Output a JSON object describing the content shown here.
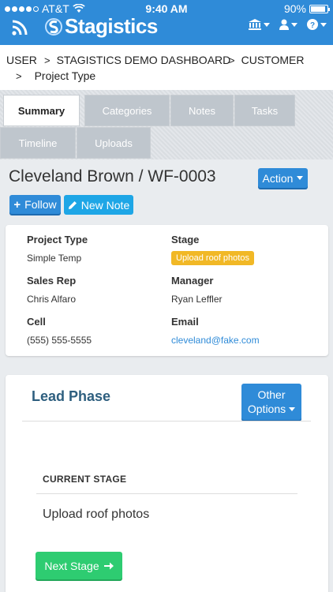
{
  "status_bar": {
    "carrier": "AT&T",
    "time": "9:40 AM",
    "battery": "90%",
    "battery_level": 0.9
  },
  "navbar": {
    "logo_text": "Stagistics",
    "icons": [
      "rss-icon",
      "bank-icon",
      "user-icon",
      "help-icon"
    ]
  },
  "breadcrumb": {
    "items": [
      "USER",
      "STAGISTICS DEMO DASHBOARD",
      "CUSTOMER",
      "Project Type"
    ],
    "separator": ">"
  },
  "tabs": [
    {
      "label": "Summary",
      "active": true
    },
    {
      "label": "Categories",
      "active": false
    },
    {
      "label": "Notes",
      "active": false
    },
    {
      "label": "Tasks",
      "active": false
    },
    {
      "label": "Timeline",
      "active": false
    },
    {
      "label": "Uploads",
      "active": false
    }
  ],
  "header": {
    "title": "Cleveland Brown / WF-0003",
    "action_label": "Action",
    "follow_label": "Follow",
    "new_note_label": "New Note"
  },
  "details": {
    "project_type_label": "Project Type",
    "project_type_value": "Simple Temp",
    "stage_label": "Stage",
    "stage_value": "Upload roof photos",
    "sales_rep_label": "Sales Rep",
    "sales_rep_value": "Chris Alfaro",
    "manager_label": "Manager",
    "manager_value": "Ryan Leffler",
    "cell_label": "Cell",
    "cell_value": "(555) 555-5555",
    "email_label": "Email",
    "email_value": "cleveland@fake.com"
  },
  "phase": {
    "title": "Lead Phase",
    "other_options_line1": "Other",
    "other_options_line2": "Options",
    "current_stage_label": "CURRENT STAGE",
    "current_stage_value": "Upload roof photos",
    "next_stage_label": "Next Stage"
  },
  "colors": {
    "primary": "#2f8bd8",
    "badge": "#f1b826",
    "success": "#2ecc71",
    "phase_title": "#2e5f7f"
  }
}
